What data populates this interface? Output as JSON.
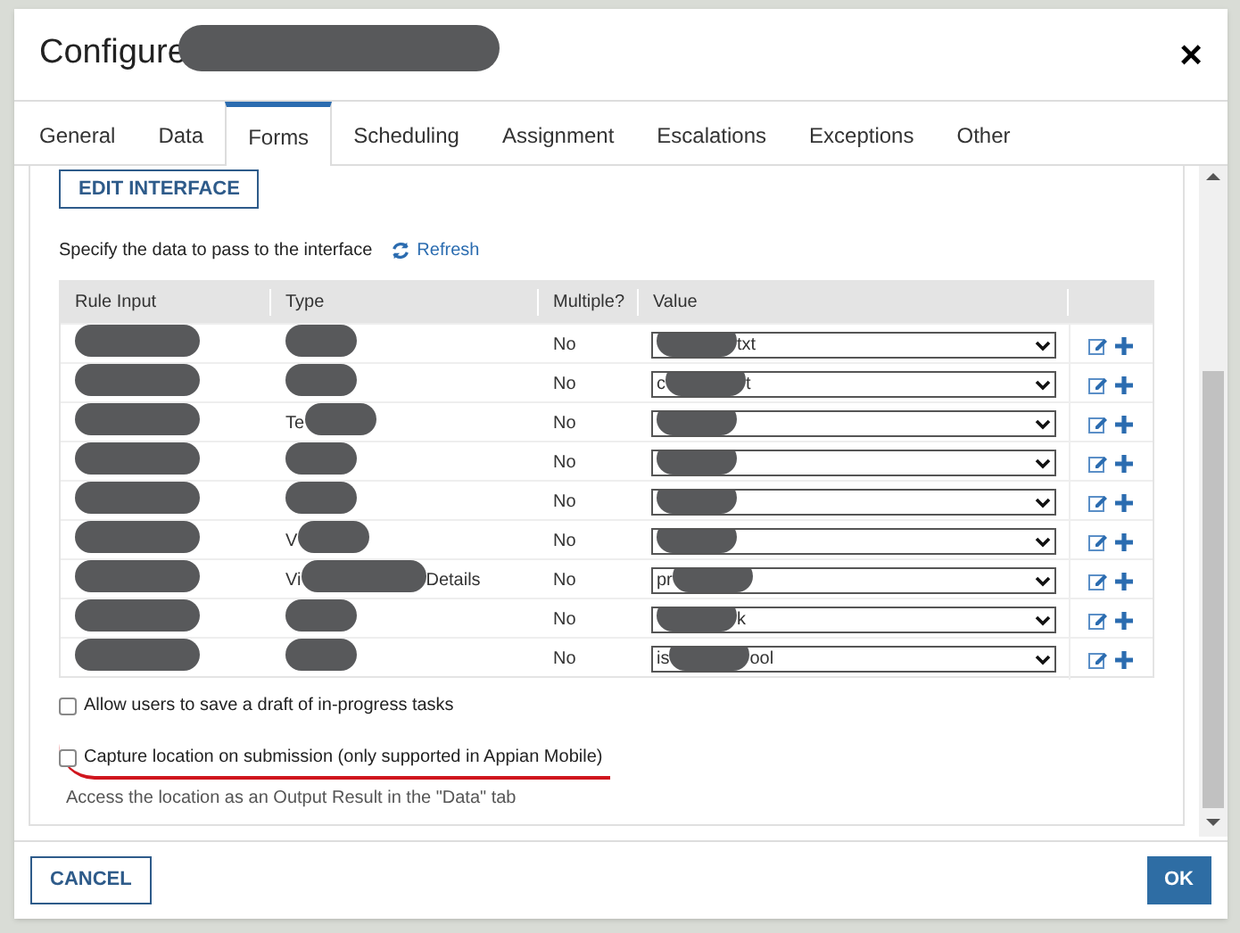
{
  "dialog": {
    "title": "Configure",
    "title_redacted": true,
    "close": "×"
  },
  "tabs": [
    {
      "label": "General",
      "selected": false
    },
    {
      "label": "Data",
      "selected": false
    },
    {
      "label": "Forms",
      "selected": true
    },
    {
      "label": "Scheduling",
      "selected": false
    },
    {
      "label": "Assignment",
      "selected": false
    },
    {
      "label": "Escalations",
      "selected": false
    },
    {
      "label": "Exceptions",
      "selected": false
    },
    {
      "label": "Other",
      "selected": false
    }
  ],
  "edit_button": "EDIT INTERFACE",
  "instruction": "Specify the data to pass to the interface",
  "refresh_link": "Refresh",
  "table": {
    "columns": [
      "Rule Input",
      "Type",
      "Multiple?",
      "Value"
    ],
    "rows": [
      {
        "rule_input": {
          "redacted": true
        },
        "type": {
          "redacted": true
        },
        "multiple": "No",
        "value": {
          "redacted": true,
          "suffix": "txt"
        }
      },
      {
        "rule_input": {
          "redacted": true
        },
        "type": {
          "redacted": true
        },
        "multiple": "No",
        "value": {
          "prefix": "c",
          "redacted": true,
          "suffix": "t"
        }
      },
      {
        "rule_input": {
          "redacted": true
        },
        "type": {
          "prefix": "Te",
          "redacted": true
        },
        "multiple": "No",
        "value": {
          "redacted": true
        }
      },
      {
        "rule_input": {
          "redacted": true
        },
        "type": {
          "redacted": true
        },
        "multiple": "No",
        "value": {
          "redacted": true
        }
      },
      {
        "rule_input": {
          "redacted": true
        },
        "type": {
          "redacted": true
        },
        "multiple": "No",
        "value": {
          "redacted": true
        }
      },
      {
        "rule_input": {
          "redacted": true
        },
        "type": {
          "prefix": "V",
          "redacted": true
        },
        "multiple": "No",
        "value": {
          "redacted": true
        }
      },
      {
        "rule_input": {
          "redacted": true
        },
        "type": {
          "prefix": "Vi",
          "redacted": true,
          "suffix": "Details"
        },
        "multiple": "No",
        "value": {
          "prefix": "pr",
          "redacted": true
        }
      },
      {
        "rule_input": {
          "redacted": true
        },
        "type": {
          "redacted": true
        },
        "multiple": "No",
        "value": {
          "redacted": true,
          "suffix": "k"
        }
      },
      {
        "rule_input": {
          "redacted": true
        },
        "type": {
          "redacted": true
        },
        "multiple": "No",
        "value": {
          "prefix": "is",
          "redacted": true,
          "suffix": "ool"
        }
      }
    ]
  },
  "options": [
    {
      "label": "Allow users to save a draft of in-progress tasks",
      "checked": false,
      "underlined": false
    },
    {
      "label": "Capture location on submission (only supported in Appian Mobile)",
      "checked": false,
      "underlined": true,
      "hint": "Access the location as an Output Result in the \"Data\" tab"
    }
  ],
  "footer": {
    "cancel": "CANCEL",
    "ok": "OK"
  }
}
